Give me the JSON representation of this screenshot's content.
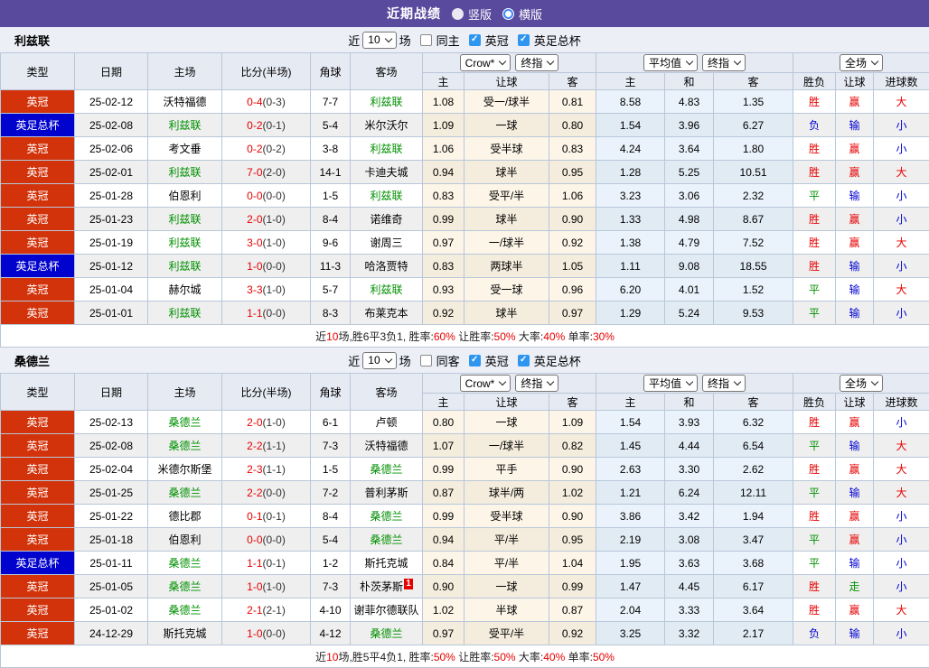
{
  "topbar": {
    "title": "近期战绩",
    "options": [
      {
        "label": "竖版",
        "selected": true
      },
      {
        "label": "横版",
        "selected": false
      }
    ]
  },
  "colors": {
    "topbar_bg": "#5a4a9e",
    "type_badge": {
      "英冠": "#d2330b",
      "英足总杯": "#0202cf"
    },
    "result_text": {
      "胜": "#e60000",
      "平": "#009000",
      "负": "#0000d0",
      "赢": "#e60000",
      "输": "#0000d0",
      "走": "#009000",
      "大": "#e60000",
      "小": "#0000d0"
    },
    "team_highlight": "#009000",
    "score_red": "#e60000"
  },
  "columns": [
    "类型",
    "日期",
    "主场",
    "比分(半场)",
    "角球",
    "客场"
  ],
  "sub_columns": [
    "主",
    "让球",
    "客",
    "主",
    "和",
    "客",
    "胜负",
    "让球",
    "进球数"
  ],
  "selects": {
    "bookmaker": "Crow*",
    "odds_final": "终指",
    "avg": "平均值",
    "avg_final": "终指",
    "scope": "全场"
  },
  "tables": [
    {
      "team": "利兹联",
      "filter": {
        "near": "近",
        "count": "10",
        "unit": "场",
        "same": {
          "label": "同主",
          "checked": false
        },
        "leagues": [
          {
            "label": "英冠",
            "checked": true
          },
          {
            "label": "英足总杯",
            "checked": true
          }
        ]
      },
      "rows": [
        {
          "type": "英冠",
          "date": "25-02-12",
          "home": "沃特福德",
          "home_hl": false,
          "score": "0-4",
          "half": "(0-3)",
          "corners": "7-7",
          "away": "利兹联",
          "away_hl": true,
          "away_badge": "",
          "odds": [
            "1.08",
            "受一/球半",
            "0.81"
          ],
          "avg": [
            "8.58",
            "4.83",
            "1.35"
          ],
          "result": [
            "胜",
            "赢",
            "大"
          ]
        },
        {
          "type": "英足总杯",
          "date": "25-02-08",
          "home": "利兹联",
          "home_hl": true,
          "score": "0-2",
          "half": "(0-1)",
          "corners": "5-4",
          "away": "米尔沃尔",
          "away_hl": false,
          "away_badge": "",
          "odds": [
            "1.09",
            "一球",
            "0.80"
          ],
          "avg": [
            "1.54",
            "3.96",
            "6.27"
          ],
          "result": [
            "负",
            "输",
            "小"
          ]
        },
        {
          "type": "英冠",
          "date": "25-02-06",
          "home": "考文垂",
          "home_hl": false,
          "score": "0-2",
          "half": "(0-2)",
          "corners": "3-8",
          "away": "利兹联",
          "away_hl": true,
          "away_badge": "",
          "odds": [
            "1.06",
            "受半球",
            "0.83"
          ],
          "avg": [
            "4.24",
            "3.64",
            "1.80"
          ],
          "result": [
            "胜",
            "赢",
            "小"
          ]
        },
        {
          "type": "英冠",
          "date": "25-02-01",
          "home": "利兹联",
          "home_hl": true,
          "score": "7-0",
          "half": "(2-0)",
          "corners": "14-1",
          "away": "卡迪夫城",
          "away_hl": false,
          "away_badge": "",
          "odds": [
            "0.94",
            "球半",
            "0.95"
          ],
          "avg": [
            "1.28",
            "5.25",
            "10.51"
          ],
          "result": [
            "胜",
            "赢",
            "大"
          ]
        },
        {
          "type": "英冠",
          "date": "25-01-28",
          "home": "伯恩利",
          "home_hl": false,
          "score": "0-0",
          "half": "(0-0)",
          "corners": "1-5",
          "away": "利兹联",
          "away_hl": true,
          "away_badge": "",
          "odds": [
            "0.83",
            "受平/半",
            "1.06"
          ],
          "avg": [
            "3.23",
            "3.06",
            "2.32"
          ],
          "result": [
            "平",
            "输",
            "小"
          ]
        },
        {
          "type": "英冠",
          "date": "25-01-23",
          "home": "利兹联",
          "home_hl": true,
          "score": "2-0",
          "half": "(1-0)",
          "corners": "8-4",
          "away": "诺维奇",
          "away_hl": false,
          "away_badge": "",
          "odds": [
            "0.99",
            "球半",
            "0.90"
          ],
          "avg": [
            "1.33",
            "4.98",
            "8.67"
          ],
          "result": [
            "胜",
            "赢",
            "小"
          ]
        },
        {
          "type": "英冠",
          "date": "25-01-19",
          "home": "利兹联",
          "home_hl": true,
          "score": "3-0",
          "half": "(1-0)",
          "corners": "9-6",
          "away": "谢周三",
          "away_hl": false,
          "away_badge": "",
          "odds": [
            "0.97",
            "一/球半",
            "0.92"
          ],
          "avg": [
            "1.38",
            "4.79",
            "7.52"
          ],
          "result": [
            "胜",
            "赢",
            "大"
          ]
        },
        {
          "type": "英足总杯",
          "date": "25-01-12",
          "home": "利兹联",
          "home_hl": true,
          "score": "1-0",
          "half": "(0-0)",
          "corners": "11-3",
          "away": "哈洛贾特",
          "away_hl": false,
          "away_badge": "",
          "odds": [
            "0.83",
            "两球半",
            "1.05"
          ],
          "avg": [
            "1.11",
            "9.08",
            "18.55"
          ],
          "result": [
            "胜",
            "输",
            "小"
          ]
        },
        {
          "type": "英冠",
          "date": "25-01-04",
          "home": "赫尔城",
          "home_hl": false,
          "score": "3-3",
          "half": "(1-0)",
          "corners": "5-7",
          "away": "利兹联",
          "away_hl": true,
          "away_badge": "",
          "odds": [
            "0.93",
            "受一球",
            "0.96"
          ],
          "avg": [
            "6.20",
            "4.01",
            "1.52"
          ],
          "result": [
            "平",
            "输",
            "大"
          ]
        },
        {
          "type": "英冠",
          "date": "25-01-01",
          "home": "利兹联",
          "home_hl": true,
          "score": "1-1",
          "half": "(0-0)",
          "corners": "8-3",
          "away": "布莱克本",
          "away_hl": false,
          "away_badge": "",
          "odds": [
            "0.92",
            "球半",
            "0.97"
          ],
          "avg": [
            "1.29",
            "5.24",
            "9.53"
          ],
          "result": [
            "平",
            "输",
            "小"
          ]
        }
      ],
      "summary": [
        [
          "近",
          "k"
        ],
        [
          "10",
          "r"
        ],
        [
          "场,胜6平3负1, 胜率:",
          "k"
        ],
        [
          "60%",
          "r"
        ],
        [
          " 让胜率:",
          "k"
        ],
        [
          "50%",
          "r"
        ],
        [
          " 大率:",
          "k"
        ],
        [
          "40%",
          "r"
        ],
        [
          " 单率:",
          "k"
        ],
        [
          "30%",
          "r"
        ]
      ]
    },
    {
      "team": "桑德兰",
      "filter": {
        "near": "近",
        "count": "10",
        "unit": "场",
        "same": {
          "label": "同客",
          "checked": false
        },
        "leagues": [
          {
            "label": "英冠",
            "checked": true
          },
          {
            "label": "英足总杯",
            "checked": true
          }
        ]
      },
      "rows": [
        {
          "type": "英冠",
          "date": "25-02-13",
          "home": "桑德兰",
          "home_hl": true,
          "score": "2-0",
          "half": "(1-0)",
          "corners": "6-1",
          "away": "卢顿",
          "away_hl": false,
          "away_badge": "",
          "odds": [
            "0.80",
            "一球",
            "1.09"
          ],
          "avg": [
            "1.54",
            "3.93",
            "6.32"
          ],
          "result": [
            "胜",
            "赢",
            "小"
          ]
        },
        {
          "type": "英冠",
          "date": "25-02-08",
          "home": "桑德兰",
          "home_hl": true,
          "score": "2-2",
          "half": "(1-1)",
          "corners": "7-3",
          "away": "沃特福德",
          "away_hl": false,
          "away_badge": "",
          "odds": [
            "1.07",
            "一/球半",
            "0.82"
          ],
          "avg": [
            "1.45",
            "4.44",
            "6.54"
          ],
          "result": [
            "平",
            "输",
            "大"
          ]
        },
        {
          "type": "英冠",
          "date": "25-02-04",
          "home": "米德尔斯堡",
          "home_hl": false,
          "score": "2-3",
          "half": "(1-1)",
          "corners": "1-5",
          "away": "桑德兰",
          "away_hl": true,
          "away_badge": "",
          "odds": [
            "0.99",
            "平手",
            "0.90"
          ],
          "avg": [
            "2.63",
            "3.30",
            "2.62"
          ],
          "result": [
            "胜",
            "赢",
            "大"
          ]
        },
        {
          "type": "英冠",
          "date": "25-01-25",
          "home": "桑德兰",
          "home_hl": true,
          "score": "2-2",
          "half": "(0-0)",
          "corners": "7-2",
          "away": "普利茅斯",
          "away_hl": false,
          "away_badge": "",
          "odds": [
            "0.87",
            "球半/两",
            "1.02"
          ],
          "avg": [
            "1.21",
            "6.24",
            "12.11"
          ],
          "result": [
            "平",
            "输",
            "大"
          ]
        },
        {
          "type": "英冠",
          "date": "25-01-22",
          "home": "德比郡",
          "home_hl": false,
          "score": "0-1",
          "half": "(0-1)",
          "corners": "8-4",
          "away": "桑德兰",
          "away_hl": true,
          "away_badge": "",
          "odds": [
            "0.99",
            "受半球",
            "0.90"
          ],
          "avg": [
            "3.86",
            "3.42",
            "1.94"
          ],
          "result": [
            "胜",
            "赢",
            "小"
          ]
        },
        {
          "type": "英冠",
          "date": "25-01-18",
          "home": "伯恩利",
          "home_hl": false,
          "score": "0-0",
          "half": "(0-0)",
          "corners": "5-4",
          "away": "桑德兰",
          "away_hl": true,
          "away_badge": "",
          "odds": [
            "0.94",
            "平/半",
            "0.95"
          ],
          "avg": [
            "2.19",
            "3.08",
            "3.47"
          ],
          "result": [
            "平",
            "赢",
            "小"
          ]
        },
        {
          "type": "英足总杯",
          "date": "25-01-11",
          "home": "桑德兰",
          "home_hl": true,
          "score": "1-1",
          "half": "(0-1)",
          "corners": "1-2",
          "away": "斯托克城",
          "away_hl": false,
          "away_badge": "",
          "odds": [
            "0.84",
            "平/半",
            "1.04"
          ],
          "avg": [
            "1.95",
            "3.63",
            "3.68"
          ],
          "result": [
            "平",
            "输",
            "小"
          ]
        },
        {
          "type": "英冠",
          "date": "25-01-05",
          "home": "桑德兰",
          "home_hl": true,
          "score": "1-0",
          "half": "(1-0)",
          "corners": "7-3",
          "away": "朴茨茅斯",
          "away_hl": false,
          "away_badge": "1",
          "odds": [
            "0.90",
            "一球",
            "0.99"
          ],
          "avg": [
            "1.47",
            "4.45",
            "6.17"
          ],
          "result": [
            "胜",
            "走",
            "小"
          ]
        },
        {
          "type": "英冠",
          "date": "25-01-02",
          "home": "桑德兰",
          "home_hl": true,
          "score": "2-1",
          "half": "(2-1)",
          "corners": "4-10",
          "away": "谢菲尔德联队",
          "away_hl": false,
          "away_badge": "",
          "odds": [
            "1.02",
            "半球",
            "0.87"
          ],
          "avg": [
            "2.04",
            "3.33",
            "3.64"
          ],
          "result": [
            "胜",
            "赢",
            "大"
          ]
        },
        {
          "type": "英冠",
          "date": "24-12-29",
          "home": "斯托克城",
          "home_hl": false,
          "score": "1-0",
          "half": "(0-0)",
          "corners": "4-12",
          "away": "桑德兰",
          "away_hl": true,
          "away_badge": "",
          "odds": [
            "0.97",
            "受平/半",
            "0.92"
          ],
          "avg": [
            "3.25",
            "3.32",
            "2.17"
          ],
          "result": [
            "负",
            "输",
            "小"
          ]
        }
      ],
      "summary": [
        [
          "近",
          "k"
        ],
        [
          "10",
          "r"
        ],
        [
          "场,胜5平4负1, 胜率:",
          "k"
        ],
        [
          "50%",
          "r"
        ],
        [
          " 让胜率:",
          "k"
        ],
        [
          "50%",
          "r"
        ],
        [
          " 大率:",
          "k"
        ],
        [
          "40%",
          "r"
        ],
        [
          " 单率:",
          "k"
        ],
        [
          "50%",
          "r"
        ]
      ]
    }
  ]
}
